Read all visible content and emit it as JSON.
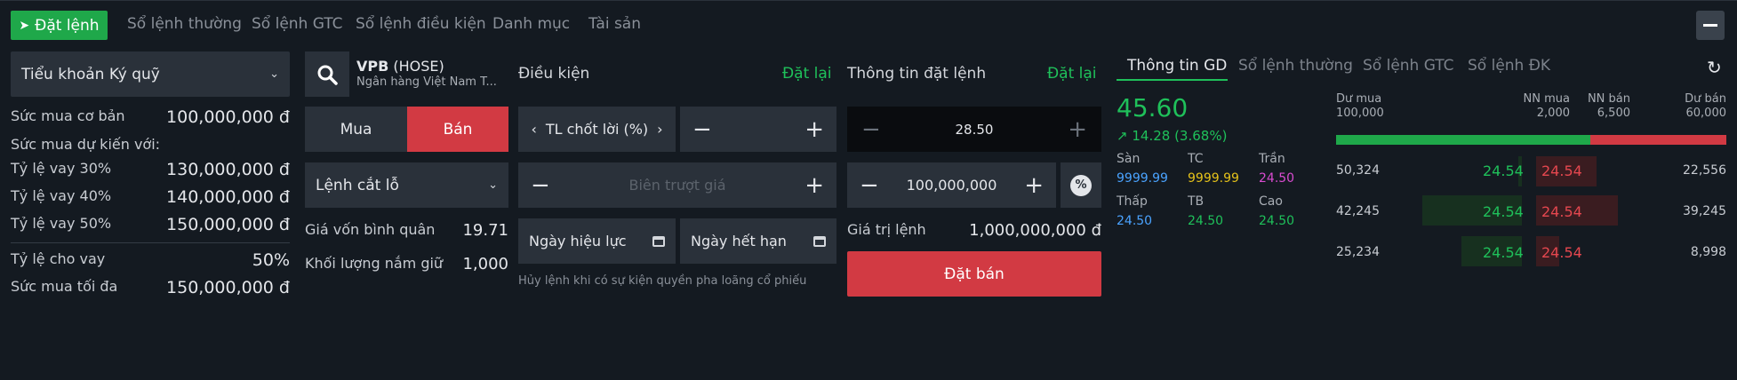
{
  "top": {
    "order_label": "Đặt lệnh",
    "tabs": [
      "Sổ lệnh thường",
      "Sổ lệnh GTC",
      "Sổ lệnh điều kiện",
      "Danh mục",
      "Tài sản"
    ]
  },
  "account": {
    "selected": "Tiểu khoản Ký quỹ",
    "base_power_label": "Sức mua cơ bản",
    "base_power_value": "100,000,000 đ",
    "expected_label": "Sức mua dự kiến với:",
    "rates": [
      {
        "label": "Tỷ lệ vay 30%",
        "value": "130,000,000 đ"
      },
      {
        "label": "Tỷ lệ vay 40%",
        "value": "140,000,000 đ"
      },
      {
        "label": "Tỷ lệ vay 50%",
        "value": "150,000,000 đ"
      }
    ],
    "loan_ratio_label": "Tỷ lệ cho vay",
    "loan_ratio_value": "50%",
    "max_power_label": "Sức mua tối đa",
    "max_power_value": "150,000,000 đ"
  },
  "symbol": {
    "code": "VPB",
    "exchange": "(HOSE)",
    "name": "Ngân hàng Việt Nam T...",
    "buy_label": "Mua",
    "sell_label": "Bán",
    "order_type": "Lệnh cắt lỗ",
    "avg_cost_label": "Giá vốn bình quân",
    "avg_cost_value": "19.71",
    "holding_label": "Khối lượng nắm giữ",
    "holding_value": "1,000"
  },
  "condition": {
    "title": "Điều kiện",
    "reset": "Đặt lại",
    "take_profit_label": "TL chốt lời (%)",
    "trailing_placeholder": "Biên trượt giá",
    "effective_date": "Ngày hiệu lực",
    "expiry_date": "Ngày hết hạn",
    "note": "Hủy lệnh khi có sự kiện quyền pha loãng cổ phiếu"
  },
  "order_info": {
    "title": "Thông tin đặt lệnh",
    "reset": "Đặt lại",
    "price": "28.50",
    "quantity": "100,000,000",
    "value_label": "Giá trị lệnh",
    "value": "1,000,000,000 đ",
    "submit": "Đặt bán"
  },
  "market": {
    "tabs": [
      "Thông tin GD",
      "Sổ lệnh thường",
      "Sổ lệnh GTC",
      "Sổ lệnh ĐK"
    ],
    "price": "45.60",
    "change": "14.28 (3.68%)",
    "stats": [
      {
        "label": "Sàn",
        "value": "9999.99",
        "color": "#4aa3ff"
      },
      {
        "label": "TC",
        "value": "9999.99",
        "color": "#e5c21a"
      },
      {
        "label": "Trần",
        "value": "24.50",
        "color": "#d94bd0"
      },
      {
        "label": "Thấp",
        "value": "24.50",
        "color": "#4aa3ff"
      },
      {
        "label": "TB",
        "value": "24.50",
        "color": "#1fc05a"
      },
      {
        "label": "Cao",
        "value": "24.50",
        "color": "#1fc05a"
      }
    ]
  },
  "orderbook": {
    "bid_label": "Dư mua",
    "bid_total": "100,000",
    "foreign_buy_label": "NN mua",
    "foreign_buy": "2,000",
    "foreign_sell_label": "NN bán",
    "foreign_sell": "6,500",
    "ask_label": "Dư bán",
    "ask_total": "60,000",
    "rows": [
      {
        "bid_vol": "50,324",
        "bid_px": "24.54",
        "ask_px": "24.54",
        "ask_vol": "22,556"
      },
      {
        "bid_vol": "42,245",
        "bid_px": "24.54",
        "ask_px": "24.54",
        "ask_vol": "39,245"
      },
      {
        "bid_vol": "25,234",
        "bid_px": "24.54",
        "ask_px": "24.54",
        "ask_vol": "8,998"
      }
    ]
  }
}
